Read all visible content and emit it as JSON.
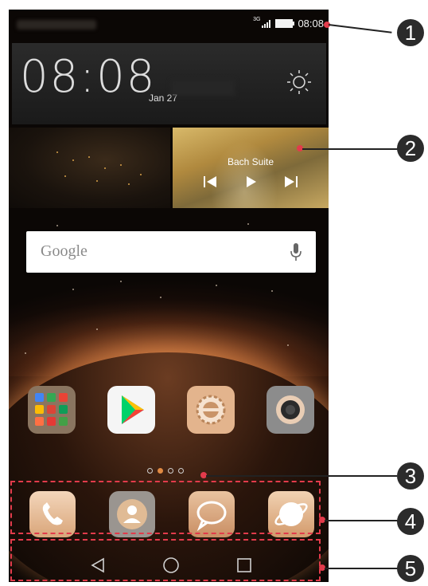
{
  "status_bar": {
    "network": "3G",
    "time": "08:08"
  },
  "clock_widget": {
    "time": "08:08",
    "date": "Jan 27",
    "weather_icon": "sun-icon"
  },
  "music_widget": {
    "song_title": "Bach Suite",
    "controls": [
      "previous-icon",
      "play-icon",
      "next-icon"
    ]
  },
  "search_bar": {
    "text": "Google",
    "icon": "mic-icon"
  },
  "home_apps": [
    {
      "name": "app-folder",
      "icon": "folder-icon"
    },
    {
      "name": "play-store",
      "icon": "play-store-icon"
    },
    {
      "name": "settings",
      "icon": "gear-icon"
    },
    {
      "name": "camera",
      "icon": "camera-icon"
    }
  ],
  "page_indicator": {
    "count": 4,
    "active_index": 1
  },
  "dock_apps": [
    {
      "name": "phone",
      "icon": "phone-icon"
    },
    {
      "name": "contacts",
      "icon": "contacts-icon"
    },
    {
      "name": "messages",
      "icon": "messages-icon"
    },
    {
      "name": "browser",
      "icon": "browser-icon"
    }
  ],
  "nav_bar": [
    "back-icon",
    "home-icon",
    "recents-icon"
  ],
  "callouts": [
    "1",
    "2",
    "3",
    "4",
    "5"
  ],
  "colors": {
    "annotation_red": "#e23b4b",
    "badge": "#2b2b2b",
    "accent": "#e08a43"
  }
}
